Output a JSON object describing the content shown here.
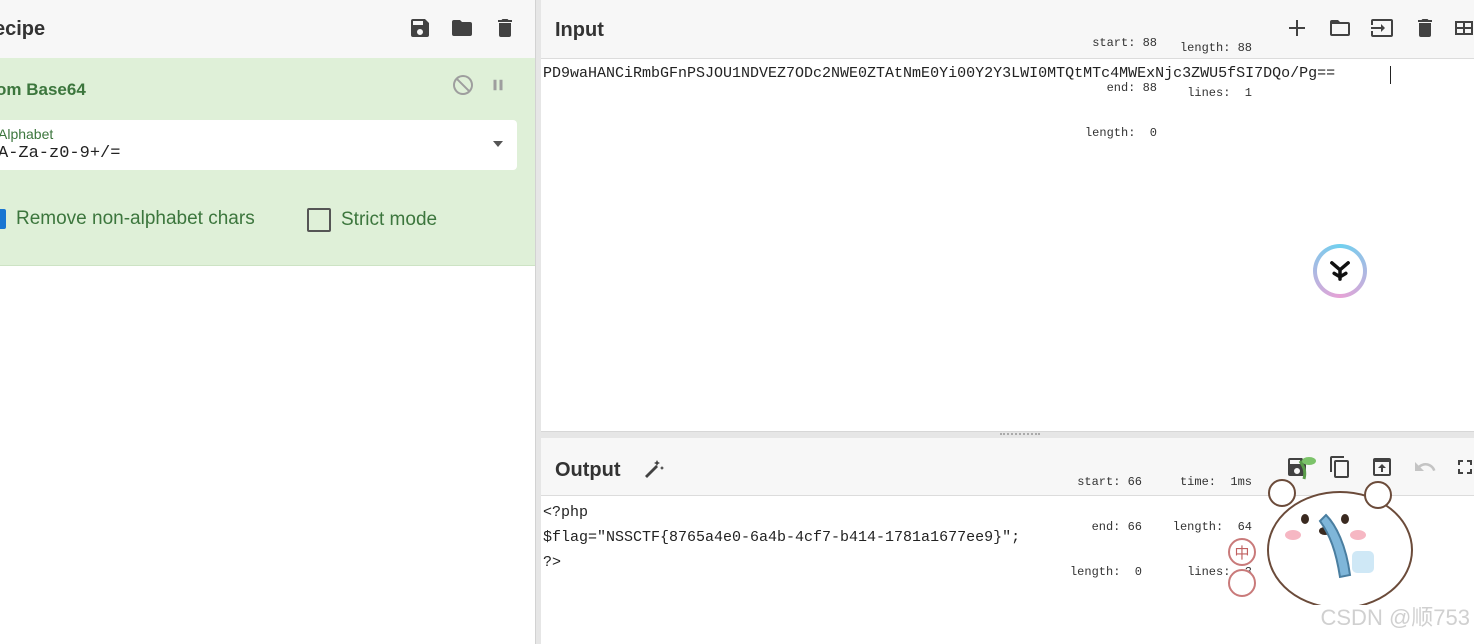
{
  "recipe": {
    "title": "ecipe",
    "icons": [
      "save-icon",
      "folder-icon",
      "trash-icon"
    ],
    "operation": {
      "name": "om Base64",
      "alphabet_label": "Alphabet",
      "alphabet_value": "A-Za-z0-9+/=",
      "checkbox_remove_label": "Remove non-alphabet chars",
      "checkbox_remove_checked": true,
      "checkbox_strict_label": "Strict mode",
      "checkbox_strict_checked": false
    }
  },
  "input": {
    "title": "Input",
    "stats_left": [
      "start: 88",
      "end: 88",
      "length:  0"
    ],
    "stats_right": [
      "length: 88",
      "lines:  1"
    ],
    "text": "PD9waHANCiRmbGFnPSJOU1NDVEZ7ODc2NWE0ZTAtNmE0Yi00Y2Y3LWI0MTQtMTc4MWExNjc3ZWU5fSI7DQo/Pg=="
  },
  "output": {
    "title": "Output",
    "stats_left": [
      "start: 66",
      "end: 66",
      "length:  0"
    ],
    "stats_right": [
      "time:  1ms",
      "length:  64",
      "lines:  3"
    ],
    "lines": [
      "<?php",
      "$flag=\"NSSCTF{8765a4e0-6a4b-4cf7-b414-1781a1677ee9}\";",
      "?>"
    ]
  },
  "overlay": {
    "watermark": "CSDN @顺753",
    "badge_char": "中"
  },
  "colors": {
    "op_bg": "#dff0d8",
    "op_text": "#3c763d",
    "checkbox_on": "#1976d2"
  }
}
